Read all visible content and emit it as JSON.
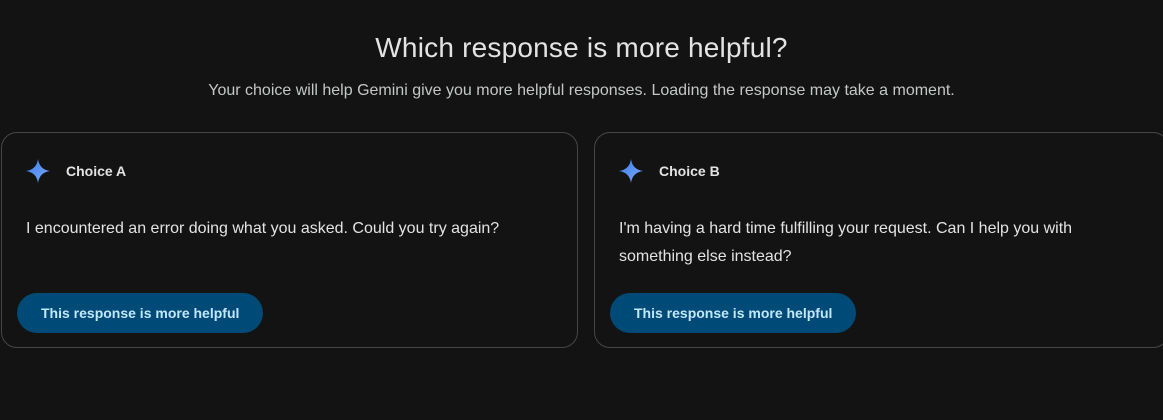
{
  "header": {
    "title": "Which response is more helpful?",
    "subtitle": "Your choice will help Gemini give you more helpful responses. Loading the response may take a moment."
  },
  "choices": [
    {
      "label": "Choice A",
      "icon": "gemini-sparkle-icon",
      "text": "I encountered an error doing what you asked. Could you try again?",
      "button_label": "This response is more helpful"
    },
    {
      "label": "Choice B",
      "icon": "gemini-sparkle-icon",
      "text": "I'm having a hard time fulfilling your request. Can I help you with something else instead?",
      "button_label": "This response is more helpful"
    }
  ],
  "colors": {
    "background": "#131314",
    "card_border": "#444746",
    "button_bg": "#004a77",
    "button_text": "#c2e7ff",
    "sparkle": "#4a8af4"
  }
}
